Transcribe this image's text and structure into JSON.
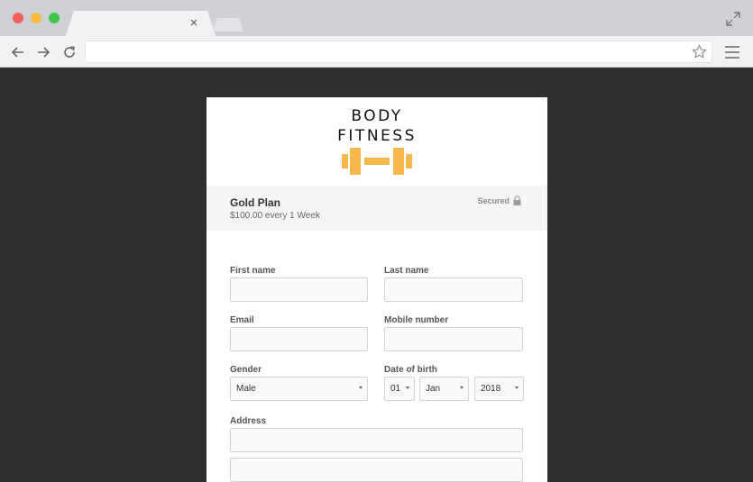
{
  "browser": {
    "tab_close_glyph": "×"
  },
  "brand": {
    "line1": "BODY",
    "line2": "FITNESS",
    "accent_color": "#f7b84b"
  },
  "plan": {
    "name": "Gold Plan",
    "price": "$100.00 every 1 Week",
    "secured_label": "Secured"
  },
  "form": {
    "first_name_label": "First name",
    "last_name_label": "Last name",
    "email_label": "Email",
    "mobile_label": "Mobile number",
    "gender_label": "Gender",
    "gender_value": "Male",
    "dob_label": "Date of birth",
    "dob_day": "01",
    "dob_month": "Jan",
    "dob_year": "2018",
    "address_label": "Address"
  }
}
